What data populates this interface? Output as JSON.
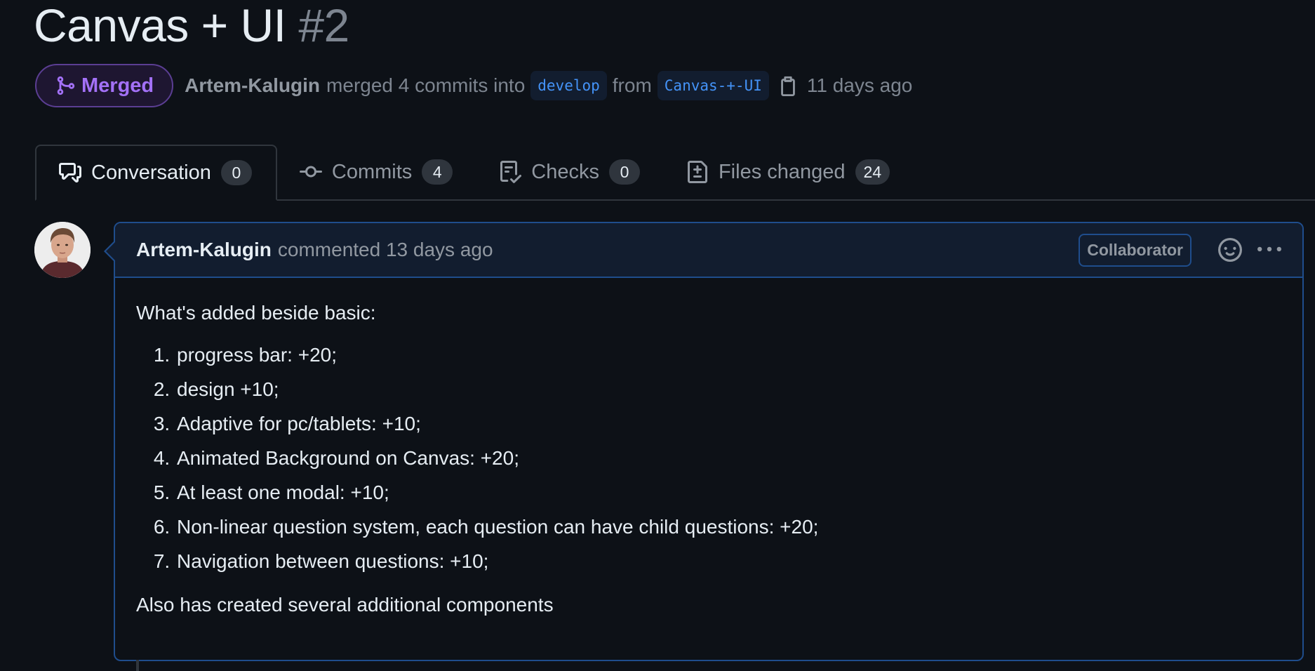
{
  "title": {
    "text": "Canvas + UI",
    "number": "#2"
  },
  "meta": {
    "state_label": "Merged",
    "author": "Artem-Kalugin",
    "action_text": "merged 4 commits into",
    "base_branch": "develop",
    "from_text": "from",
    "head_branch": "Canvas-+-UI",
    "time": "11 days ago"
  },
  "tabs": [
    {
      "label": "Conversation",
      "count": "0",
      "icon": "comment-discussion-icon",
      "active": true
    },
    {
      "label": "Commits",
      "count": "4",
      "icon": "git-commit-icon",
      "active": false
    },
    {
      "label": "Checks",
      "count": "0",
      "icon": "checklist-icon",
      "active": false
    },
    {
      "label": "Files changed",
      "count": "24",
      "icon": "file-diff-icon",
      "active": false
    }
  ],
  "comment": {
    "author": "Artem-Kalugin",
    "meta": "commented 13 days ago",
    "role_badge": "Collaborator",
    "intro": "What's added beside basic:",
    "items": [
      "progress bar: +20;",
      "design +10;",
      "Adaptive for pc/tablets: +10;",
      "Animated Background on Canvas: +20;",
      "At least one modal: +10;",
      "Non-linear question system, each question can have child questions: +20;",
      "Navigation between questions: +10;"
    ],
    "outro": "Also has created several additional components"
  },
  "colors": {
    "background": "#0d1117",
    "merged_purple": "#a371f7",
    "branch_blue": "#4493f8",
    "comment_border": "#1f4d8c"
  }
}
